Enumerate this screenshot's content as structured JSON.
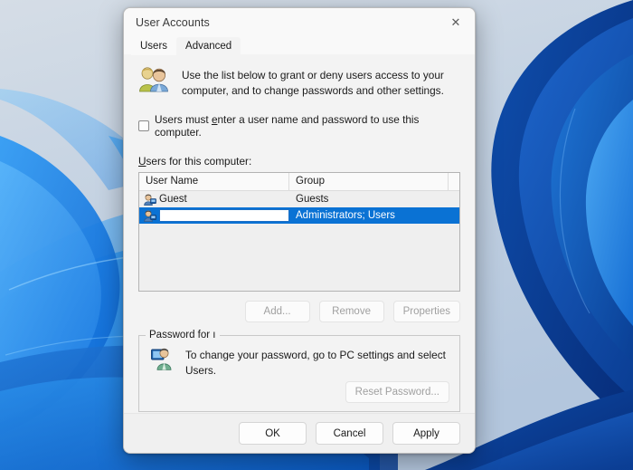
{
  "desktop": {
    "name": "windows-11-bloom-wallpaper"
  },
  "window": {
    "title": "User Accounts",
    "close_icon": "close-icon",
    "close_glyph": "✕"
  },
  "tabs": [
    {
      "label": "Users",
      "active": true
    },
    {
      "label": "Advanced",
      "active": false
    }
  ],
  "intro": {
    "icon": "two-users-icon",
    "line1": "Use the list below to grant or deny users access to your",
    "line2": "computer, and to change passwords and other settings."
  },
  "require_logon": {
    "checked": false,
    "label_pre": "Users must ",
    "label_accel": "e",
    "label_post": "nter a user name and password to use this computer."
  },
  "list_caption": {
    "accel": "U",
    "rest": "sers for this computer:"
  },
  "listview": {
    "columns": [
      "User Name",
      "Group"
    ],
    "rows": [
      {
        "icon": "user-icon",
        "user_name": "Guest",
        "group": "Guests",
        "selected": false,
        "editing": false
      },
      {
        "icon": "user-icon",
        "user_name": "",
        "group": "Administrators; Users",
        "selected": true,
        "editing": true
      }
    ]
  },
  "list_buttons": [
    {
      "label": "Add...",
      "accel_index": 1,
      "disabled": true,
      "name": "add-button"
    },
    {
      "label": "Remove",
      "accel_index": 0,
      "disabled": true,
      "name": "remove-button"
    },
    {
      "label": "Properties",
      "accel_index": 2,
      "disabled": true,
      "name": "properties-button"
    }
  ],
  "password_group": {
    "legend": "Password for ı",
    "icon": "user-password-icon",
    "line1": "To change your password, go to PC settings and select",
    "line2": "Users.",
    "reset_button": {
      "label": "Reset Password...",
      "disabled": true
    }
  },
  "footer_buttons": [
    {
      "label": "OK",
      "name": "ok-button",
      "disabled": false
    },
    {
      "label": "Cancel",
      "name": "cancel-button",
      "disabled": false
    },
    {
      "label": "Apply",
      "name": "apply-button",
      "disabled": false
    }
  ],
  "colors": {
    "selection_blue": "#0a72d4",
    "dialog_bg": "#f3f3f3",
    "titlebar_bg": "#f9f9f9",
    "footer_bg": "#f0f0f0"
  }
}
